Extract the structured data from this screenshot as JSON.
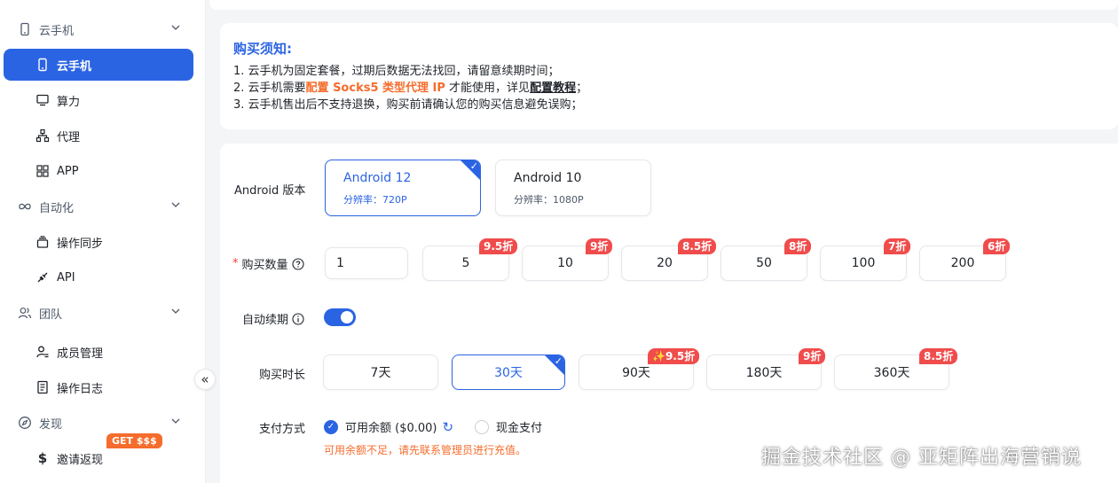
{
  "sidebar": {
    "groups": [
      {
        "label": "云手机",
        "icon": "phone-outline-icon"
      },
      {
        "label": "自动化",
        "icon": "infinity-icon"
      },
      {
        "label": "团队",
        "icon": "team-icon"
      },
      {
        "label": "发现",
        "icon": "compass-icon"
      }
    ],
    "items": [
      {
        "label": "云手机",
        "icon": "phone-icon",
        "active": true
      },
      {
        "label": "算力",
        "icon": "monitor-icon"
      },
      {
        "label": "代理",
        "icon": "network-icon"
      },
      {
        "label": "APP",
        "icon": "apps-grid-icon"
      },
      {
        "label": "操作同步",
        "icon": "sync-icon"
      },
      {
        "label": "API",
        "icon": "plug-icon"
      },
      {
        "label": "成员管理",
        "icon": "member-icon"
      },
      {
        "label": "操作日志",
        "icon": "log-icon"
      },
      {
        "label": "邀请返现",
        "icon": "dollar-icon",
        "badge": "GET $$$"
      }
    ],
    "collapse_glyph": "«"
  },
  "notice": {
    "title": "购买须知:",
    "line1": "1. 云手机为固定套餐，过期后数据无法找回，请留意续期时间；",
    "line2_prefix": "2. 云手机需要",
    "line2_highlight": "配置 Socks5 类型代理 IP",
    "line2_middle": " 才能使用，详见",
    "line2_link": "配置教程",
    "line2_suffix": "；",
    "line3": "3. 云手机售出后不支持退换，购买前请确认您的购买信息避免误购；"
  },
  "form": {
    "android_label": "Android 版本",
    "versions": [
      {
        "title": "Android 12",
        "sub": "分辨率：720P",
        "selected": true
      },
      {
        "title": "Android 10",
        "sub": "分辨率：1080P",
        "selected": false
      }
    ],
    "qty_required": "*",
    "qty_label": "购买数量",
    "qty_input": "1",
    "qty_options": [
      {
        "value": "5",
        "discount": "9.5折"
      },
      {
        "value": "10",
        "discount": "9折"
      },
      {
        "value": "20",
        "discount": "8.5折"
      },
      {
        "value": "50",
        "discount": "8折"
      },
      {
        "value": "100",
        "discount": "7折"
      },
      {
        "value": "200",
        "discount": "6折"
      }
    ],
    "auto_renew_label": "自动续期",
    "auto_renew_on": true,
    "duration_label": "购买时长",
    "durations": [
      {
        "value": "7天",
        "discount": ""
      },
      {
        "value": "30天",
        "discount": "",
        "selected": true
      },
      {
        "value": "90天",
        "discount": "✨9.5折"
      },
      {
        "value": "180天",
        "discount": "9折"
      },
      {
        "value": "360天",
        "discount": "8.5折"
      }
    ],
    "payment_label": "支付方式",
    "payment_options": [
      {
        "label": "可用余额 ($0.00)",
        "selected": true
      },
      {
        "label": "现金支付",
        "selected": false
      }
    ],
    "warning": "可用余额不足，请先联系管理员进行充值。"
  },
  "watermark": "掘金技术社区 @ 亚矩阵出海营销说",
  "colors": {
    "accent": "#2b64e3",
    "discount": "#f04c4c",
    "orange": "#f56c2c"
  }
}
